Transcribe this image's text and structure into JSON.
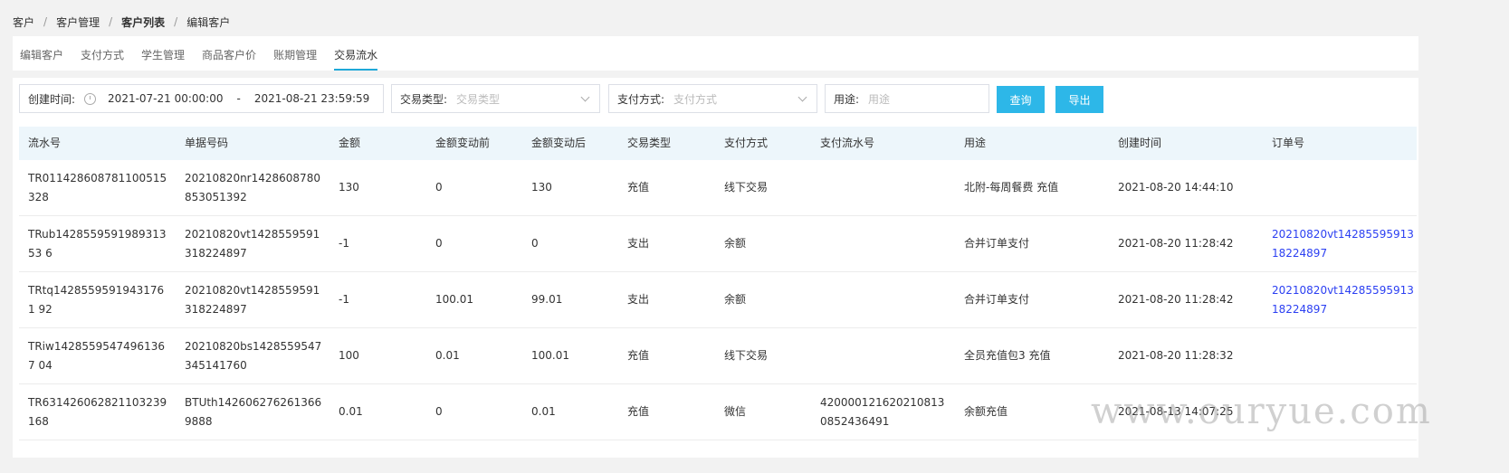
{
  "breadcrumb": {
    "items": [
      "客户",
      "客户管理",
      "客户列表",
      "编辑客户"
    ],
    "separator": "/"
  },
  "tabs": [
    {
      "label": "编辑客户"
    },
    {
      "label": "支付方式"
    },
    {
      "label": "学生管理"
    },
    {
      "label": "商品客户价"
    },
    {
      "label": "账期管理"
    },
    {
      "label": "交易流水",
      "active": true
    }
  ],
  "filters": {
    "created_label": "创建时间:",
    "created_start": "2021-07-21 00:00:00",
    "created_sep": "-",
    "created_end": "2021-08-21 23:59:59",
    "type_label": "交易类型:",
    "type_placeholder": "交易类型",
    "pay_label": "支付方式:",
    "pay_placeholder": "支付方式",
    "purpose_label": "用途:",
    "purpose_placeholder": "用途",
    "query_btn": "查询",
    "export_btn": "导出"
  },
  "table": {
    "headers": [
      "流水号",
      "单据号码",
      "金额",
      "金额变动前",
      "金额变动后",
      "交易类型",
      "支付方式",
      "支付流水号",
      "用途",
      "创建时间",
      "订单号"
    ],
    "rows": [
      [
        "TR011428608781100515328",
        "20210820nr1428608780853051392",
        "130",
        "0",
        "130",
        "充值",
        "线下交易",
        "",
        "北附-每周餐费 充值",
        "2021-08-20 14:44:10",
        ""
      ],
      [
        "TRub142855959198931353 6",
        "20210820vt1428559591318224897",
        "-1",
        "0",
        "0",
        "支出",
        "余额",
        "",
        "合并订单支付",
        "2021-08-20 11:28:42",
        "20210820vt1428559591318224897"
      ],
      [
        "TRtq14285595919431761 92",
        "20210820vt1428559591318224897",
        "-1",
        "100.01",
        "99.01",
        "支出",
        "余额",
        "",
        "合并订单支付",
        "2021-08-20 11:28:42",
        "20210820vt1428559591318224897"
      ],
      [
        "TRiw14285595474961367 04",
        "20210820bs1428559547345141760",
        "100",
        "0.01",
        "100.01",
        "充值",
        "线下交易",
        "",
        "全员充值包3 充值",
        "2021-08-20 11:28:32",
        ""
      ],
      [
        "TR631426062821103239168",
        "BTUth1426062762613669888",
        "0.01",
        "0",
        "0.01",
        "充值",
        "微信",
        "4200001216202108130852436491",
        "余额充值",
        "2021-08-13 14:07:25",
        ""
      ]
    ]
  },
  "watermark": "www.ouryue.com",
  "colors": {
    "accent": "#2db7e8",
    "link": "#2b3ff2",
    "header_bg": "#edf6fb"
  }
}
